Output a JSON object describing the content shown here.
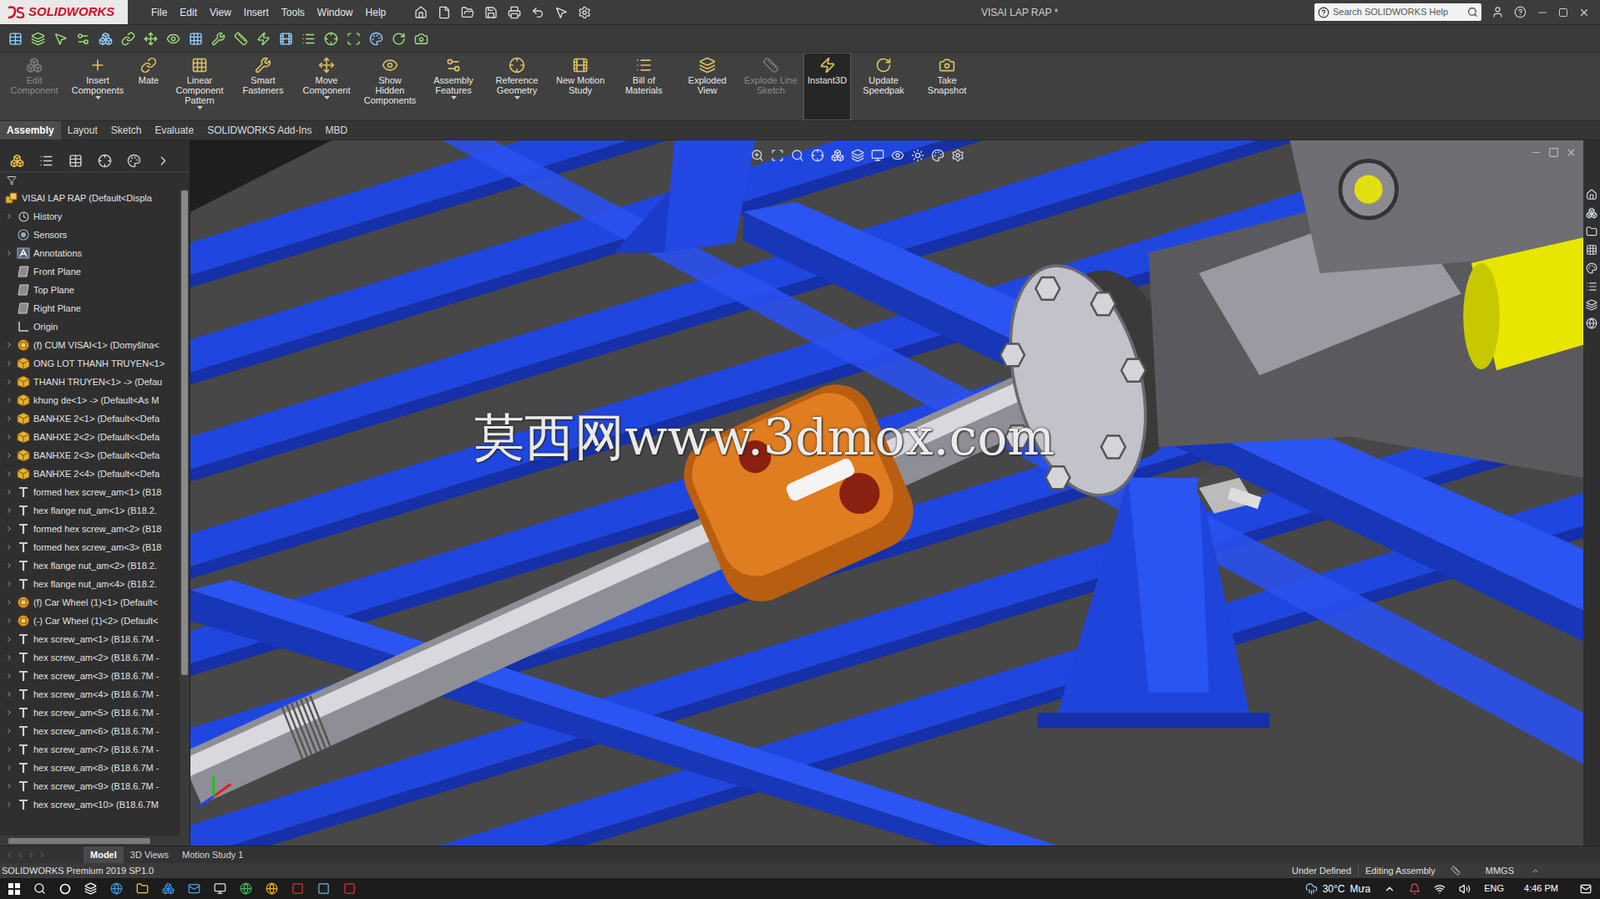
{
  "window": {
    "title": "VISAI LAP RAP *",
    "logo": "SOLIDWORKS"
  },
  "menu": [
    "File",
    "Edit",
    "View",
    "Insert",
    "Tools",
    "Window",
    "Help"
  ],
  "search": {
    "placeholder": "Search SOLIDWORKS Help"
  },
  "command_manager": [
    {
      "label": "Edit Component",
      "disabled": true,
      "selected": false,
      "dropdown": false
    },
    {
      "label": "Insert Components",
      "disabled": false,
      "selected": false,
      "dropdown": true
    },
    {
      "label": "Mate",
      "disabled": false,
      "selected": false,
      "dropdown": false
    },
    {
      "label": "Linear Component Pattern",
      "disabled": false,
      "selected": false,
      "dropdown": true
    },
    {
      "label": "Smart Fasteners",
      "disabled": false,
      "selected": false,
      "dropdown": false
    },
    {
      "label": "Move Component",
      "disabled": false,
      "selected": false,
      "dropdown": true
    },
    {
      "label": "Show Hidden Components",
      "disabled": false,
      "selected": false,
      "dropdown": false
    },
    {
      "label": "Assembly Features",
      "disabled": false,
      "selected": false,
      "dropdown": true
    },
    {
      "label": "Reference Geometry",
      "disabled": false,
      "selected": false,
      "dropdown": true
    },
    {
      "label": "New Motion Study",
      "disabled": false,
      "selected": false,
      "dropdown": false
    },
    {
      "label": "Bill of Materials",
      "disabled": false,
      "selected": false,
      "dropdown": false
    },
    {
      "label": "Exploded View",
      "disabled": false,
      "selected": false,
      "dropdown": false
    },
    {
      "label": "Explode Line Sketch",
      "disabled": true,
      "selected": false,
      "dropdown": false
    },
    {
      "label": "Instant3D",
      "disabled": false,
      "selected": true,
      "dropdown": false
    },
    {
      "label": "Update Speedpak",
      "disabled": false,
      "selected": false,
      "dropdown": false
    },
    {
      "label": "Take Snapshot",
      "disabled": false,
      "selected": false,
      "dropdown": false
    }
  ],
  "tabs": [
    {
      "label": "Assembly",
      "selected": true
    },
    {
      "label": "Layout",
      "selected": false
    },
    {
      "label": "Sketch",
      "selected": false
    },
    {
      "label": "Evaluate",
      "selected": false
    },
    {
      "label": "SOLIDWORKS Add-Ins",
      "selected": false
    },
    {
      "label": "MBD",
      "selected": false
    }
  ],
  "feature_tree": {
    "items": [
      {
        "label": "VISAI LAP RAP  (Default<Displa",
        "kind": "root",
        "expandable": false
      },
      {
        "label": "History",
        "kind": "history",
        "expandable": true
      },
      {
        "label": "Sensors",
        "kind": "sensors",
        "expandable": false
      },
      {
        "label": "Annotations",
        "kind": "annotations",
        "expandable": true
      },
      {
        "label": "Front Plane",
        "kind": "plane",
        "expandable": false
      },
      {
        "label": "Top Plane",
        "kind": "plane",
        "expandable": false
      },
      {
        "label": "Right Plane",
        "kind": "plane",
        "expandable": false
      },
      {
        "label": "Origin",
        "kind": "origin",
        "expandable": false
      },
      {
        "label": "(f) CUM VISAI<1> (Domyšlna<",
        "kind": "assembly",
        "expandable": true
      },
      {
        "label": "ONG LOT THANH TRUYEN<1>",
        "kind": "part",
        "expandable": true
      },
      {
        "label": "THANH TRUYEN<1> -> (Defau",
        "kind": "part",
        "expandable": true
      },
      {
        "label": "khung de<1> -> (Default<As M",
        "kind": "part",
        "expandable": true
      },
      {
        "label": "BANHXE 2<1> (Default<<Defa",
        "kind": "part",
        "expandable": true
      },
      {
        "label": "BANHXE 2<2> (Default<<Defa",
        "kind": "part",
        "expandable": true
      },
      {
        "label": "BANHXE 2<3> (Default<<Defa",
        "kind": "part",
        "expandable": true
      },
      {
        "label": "BANHXE 2<4> (Default<<Defa",
        "kind": "part",
        "expandable": true
      },
      {
        "label": "formed hex screw_am<1> (B18",
        "kind": "fastener",
        "expandable": true
      },
      {
        "label": "hex flange nut_am<1> (B18.2.",
        "kind": "fastener",
        "expandable": true
      },
      {
        "label": "formed hex screw_am<2> (B18",
        "kind": "fastener",
        "expandable": true
      },
      {
        "label": "formed hex screw_am<3> (B18",
        "kind": "fastener",
        "expandable": true
      },
      {
        "label": "hex flange nut_am<2> (B18.2.",
        "kind": "fastener",
        "expandable": true
      },
      {
        "label": "hex flange nut_am<4> (B18.2.",
        "kind": "fastener",
        "expandable": true
      },
      {
        "label": "(f) Car Wheel (1)<1> (Default<",
        "kind": "assembly",
        "expandable": true
      },
      {
        "label": "(-) Car Wheel (1)<2> (Default<",
        "kind": "assembly",
        "expandable": true
      },
      {
        "label": "hex screw_am<1> (B18.6.7M -",
        "kind": "fastener",
        "expandable": true
      },
      {
        "label": "hex screw_am<2> (B18.6.7M -",
        "kind": "fastener",
        "expandable": true
      },
      {
        "label": "hex screw_am<3> (B18.6.7M -",
        "kind": "fastener",
        "expandable": true
      },
      {
        "label": "hex screw_am<4> (B18.6.7M -",
        "kind": "fastener",
        "expandable": true
      },
      {
        "label": "hex screw_am<5> (B18.6.7M -",
        "kind": "fastener",
        "expandable": true
      },
      {
        "label": "hex screw_am<6> (B18.6.7M -",
        "kind": "fastener",
        "expandable": true
      },
      {
        "label": "hex screw_am<7> (B18.6.7M -",
        "kind": "fastener",
        "expandable": true
      },
      {
        "label": "hex screw_am<8> (B18.6.7M -",
        "kind": "fastener",
        "expandable": true
      },
      {
        "label": "hex screw_am<9> (B18.6.7M -",
        "kind": "fastener",
        "expandable": true
      },
      {
        "label": "hex screw_am<10> (B18.6.7M",
        "kind": "fastener",
        "expandable": true
      }
    ]
  },
  "viewport": {
    "watermark": "莫西网www.3dmox.com"
  },
  "bottom_tabs": [
    {
      "label": "Model",
      "selected": true
    },
    {
      "label": "3D Views",
      "selected": false
    },
    {
      "label": "Motion Study 1",
      "selected": false
    }
  ],
  "status_bar": {
    "product": "SOLIDWORKS Premium 2019 SP1.0",
    "state": "Under Defined",
    "mode": "Editing Assembly",
    "units": "MMGS"
  },
  "taskbar": {
    "temperature": "30°C",
    "condition": "Mưa",
    "language": "ENG",
    "time": "4:46 PM"
  }
}
